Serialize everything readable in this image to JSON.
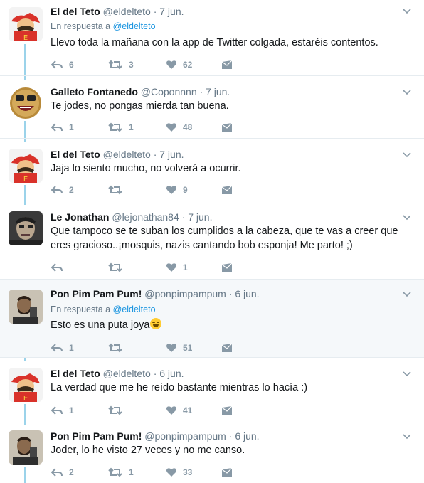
{
  "tweets": [
    {
      "name": "El del Teto",
      "handle": "@eldelteto",
      "date": "7 jun.",
      "reply_prefix": "En respuesta a",
      "reply_user": "@eldelteto",
      "text": "Llevo toda la mañana con la app de Twitter colgada, estaréis contentos.",
      "replies": "6",
      "retweets": "3",
      "likes": "62",
      "avatar": "hero-avatar"
    },
    {
      "name": "Galleto Fontanedo",
      "handle": "@Coponnnn",
      "date": "7 jun.",
      "text": "Te jodes, no pongas mierda tan buena.",
      "replies": "1",
      "retweets": "1",
      "likes": "48",
      "avatar": "cookie-avatar"
    },
    {
      "name": "El del Teto",
      "handle": "@eldelteto",
      "date": "7 jun.",
      "text": "Jaja lo siento mucho, no volverá a ocurrir.",
      "replies": "2",
      "retweets": "",
      "likes": "9",
      "avatar": "hero-avatar"
    },
    {
      "name": "Le Jonathan",
      "handle": "@lejonathan84",
      "date": "7 jun.",
      "text": "Que tampoco se te suban los cumplidos a la cabeza, que te vas a creer que eres gracioso..¡mosquis, nazis cantando bob esponja! Me parto! ;)",
      "replies": "",
      "retweets": "",
      "likes": "1",
      "avatar": "man-avatar"
    },
    {
      "name": "Pon Pim Pam Pum!",
      "handle": "@ponpimpampum",
      "date": "6 jun.",
      "reply_prefix": "En respuesta a",
      "reply_user": "@eldelteto",
      "text": "Esto es una puta joya",
      "emoji": "laughing-face",
      "replies": "1",
      "retweets": "",
      "likes": "51",
      "avatar": "bearded-avatar"
    },
    {
      "name": "El del Teto",
      "handle": "@eldelteto",
      "date": "6 jun.",
      "text": "La verdad que me he reído bastante mientras lo hacía :)",
      "replies": "1",
      "retweets": "",
      "likes": "41",
      "avatar": "hero-avatar"
    },
    {
      "name": "Pon Pim Pam Pum!",
      "handle": "@ponpimpampum",
      "date": "6 jun.",
      "text": "Joder, lo he visto 27 veces y no me canso.",
      "replies": "2",
      "retweets": "1",
      "likes": "33",
      "avatar": "bearded-avatar"
    }
  ],
  "colors": {
    "accent": "#1b95e0",
    "thread": "#9bd3ea",
    "muted": "#657786",
    "highlight": "#f5f8fa"
  }
}
